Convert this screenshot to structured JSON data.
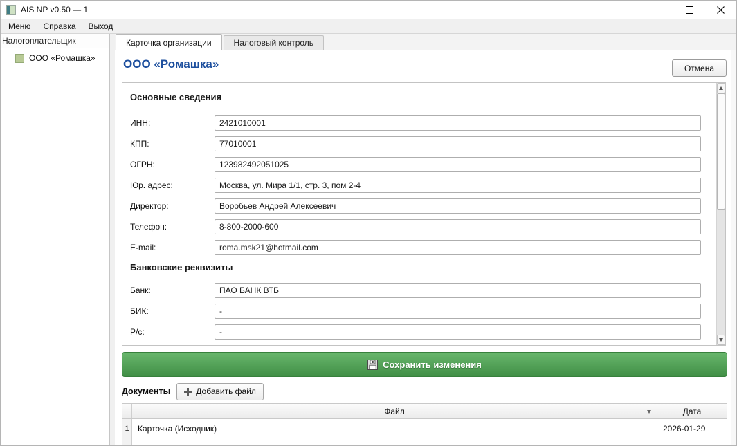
{
  "window": {
    "title": "AIS NP v0.50 — 1"
  },
  "menubar": {
    "items": [
      {
        "label": "Меню"
      },
      {
        "label": "Справка"
      },
      {
        "label": "Выход"
      }
    ]
  },
  "sidebar": {
    "header": "Налогоплательщик",
    "items": [
      {
        "label": "ООО «Ромашка»"
      }
    ]
  },
  "tabs": [
    {
      "label": "Карточка организации",
      "active": true
    },
    {
      "label": "Налоговый контроль",
      "active": false
    }
  ],
  "page": {
    "title": "ООО «Ромашка»",
    "cancel_label": "Отмена"
  },
  "form": {
    "sections": [
      {
        "heading": "Основные сведения",
        "fields": [
          {
            "label": "ИНН:",
            "value": "2421010001"
          },
          {
            "label": "КПП:",
            "value": "77010001"
          },
          {
            "label": "ОГРН:",
            "value": "123982492051025"
          },
          {
            "label": "Юр. адрес:",
            "value": "Москва, ул. Мира 1/1, стр. 3, пом 2-4"
          },
          {
            "label": "Директор:",
            "value": "Воробьев Андрей Алексеевич"
          },
          {
            "label": "Телефон:",
            "value": "8-800-2000-600"
          },
          {
            "label": "E-mail:",
            "value": "roma.msk21@hotmail.com"
          }
        ]
      },
      {
        "heading": "Банковские реквизиты",
        "fields": [
          {
            "label": "Банк:",
            "value": "ПАО БАНК ВТБ"
          },
          {
            "label": "БИК:",
            "value": "-"
          },
          {
            "label": "Р/с:",
            "value": "-"
          }
        ]
      }
    ]
  },
  "save": {
    "label": "Сохранить изменения"
  },
  "documents": {
    "label": "Документы",
    "add_file_label": "Добавить файл",
    "table": {
      "headers": {
        "file": "Файл",
        "date": "Дата"
      },
      "rows": [
        {
          "num": "1",
          "file": "Карточка (Исходник)",
          "date": "2026-01-29"
        }
      ]
    }
  },
  "icons": {
    "app": "app-logo",
    "save": "floppy-disk",
    "add": "plus",
    "file_header": "dropdown-arrow",
    "scroll_up": "triangle-up",
    "scroll_down": "triangle-down",
    "tree_item": "green-square"
  },
  "colors": {
    "accent_blue": "#1d4f9e",
    "save_green": "#4a9e50",
    "tree_icon_green": "#b8ca96"
  }
}
